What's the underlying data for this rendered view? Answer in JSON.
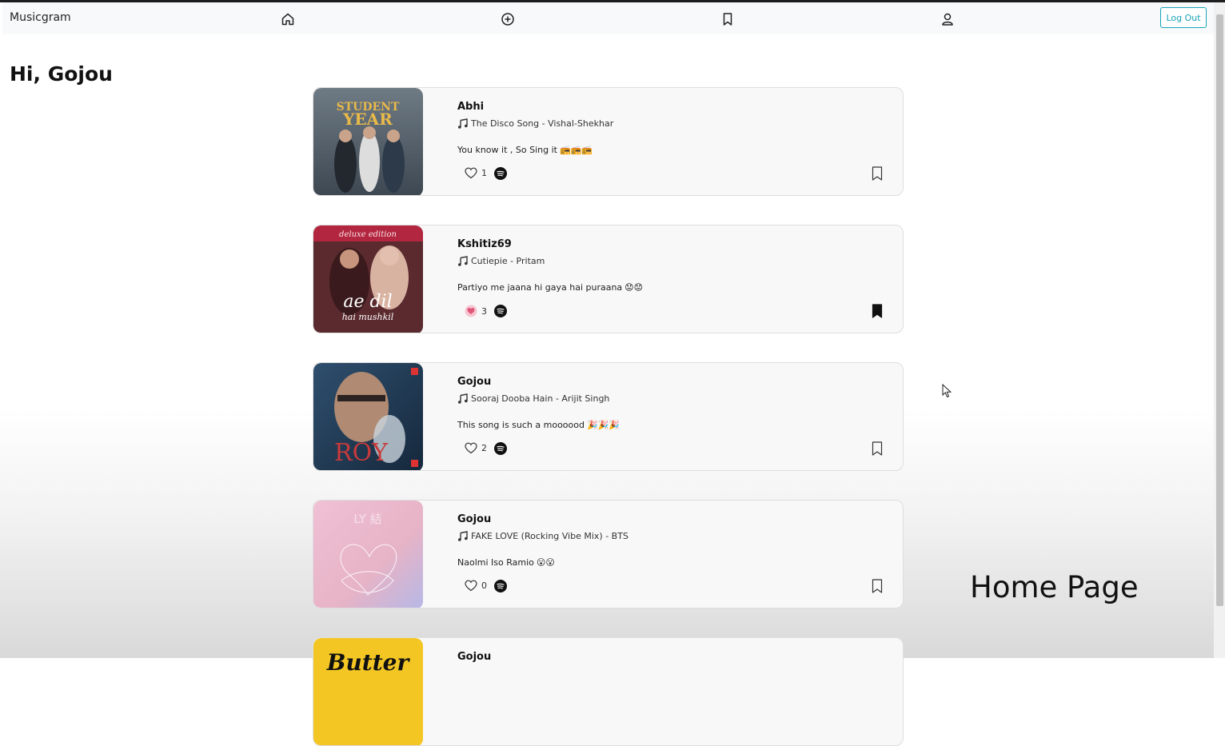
{
  "app": {
    "title": "Musicgram"
  },
  "nav": {
    "logout_label": "Log Out"
  },
  "greeting": "Hi, Gojou",
  "posts": [
    {
      "username": "Abhi",
      "song": "The Disco Song - Vishal-Shekhar",
      "caption": "You know it , So Sing it",
      "caption_emoji": "📻📻📻",
      "likes": "1",
      "liked": false,
      "bookmarked": false
    },
    {
      "username": "Kshitiz69",
      "song": "Cutiepie - Pritam",
      "caption": "Partiyo me jaana hi gaya hai puraana",
      "caption_emoji": "😟😟",
      "likes": "3",
      "liked": true,
      "bookmarked": true
    },
    {
      "username": "Gojou",
      "song": "Sooraj Dooba Hain - Arijit Singh",
      "caption": "This song is such a moooood",
      "caption_emoji": "🎉🎉🎉",
      "likes": "2",
      "liked": false,
      "bookmarked": false
    },
    {
      "username": "Gojou",
      "song": "FAKE LOVE (Rocking Vibe Mix) - BTS",
      "caption": "Naolmi Iso Ramio",
      "caption_emoji": "😮😮",
      "likes": "0",
      "liked": false,
      "bookmarked": false
    },
    {
      "username": "Gojou",
      "song": "",
      "caption": "",
      "caption_emoji": "",
      "likes": "",
      "liked": false,
      "bookmarked": false
    }
  ],
  "covers": [
    "STUDENT OF THE YEAR",
    "deluxe edition",
    "ae dil hai mushkil",
    "ROY",
    "LY 結",
    "Butter"
  ],
  "overlay": {
    "label": "Home Page"
  },
  "colors": {
    "accent": "#17a2b8",
    "liked": "#e0577a"
  }
}
